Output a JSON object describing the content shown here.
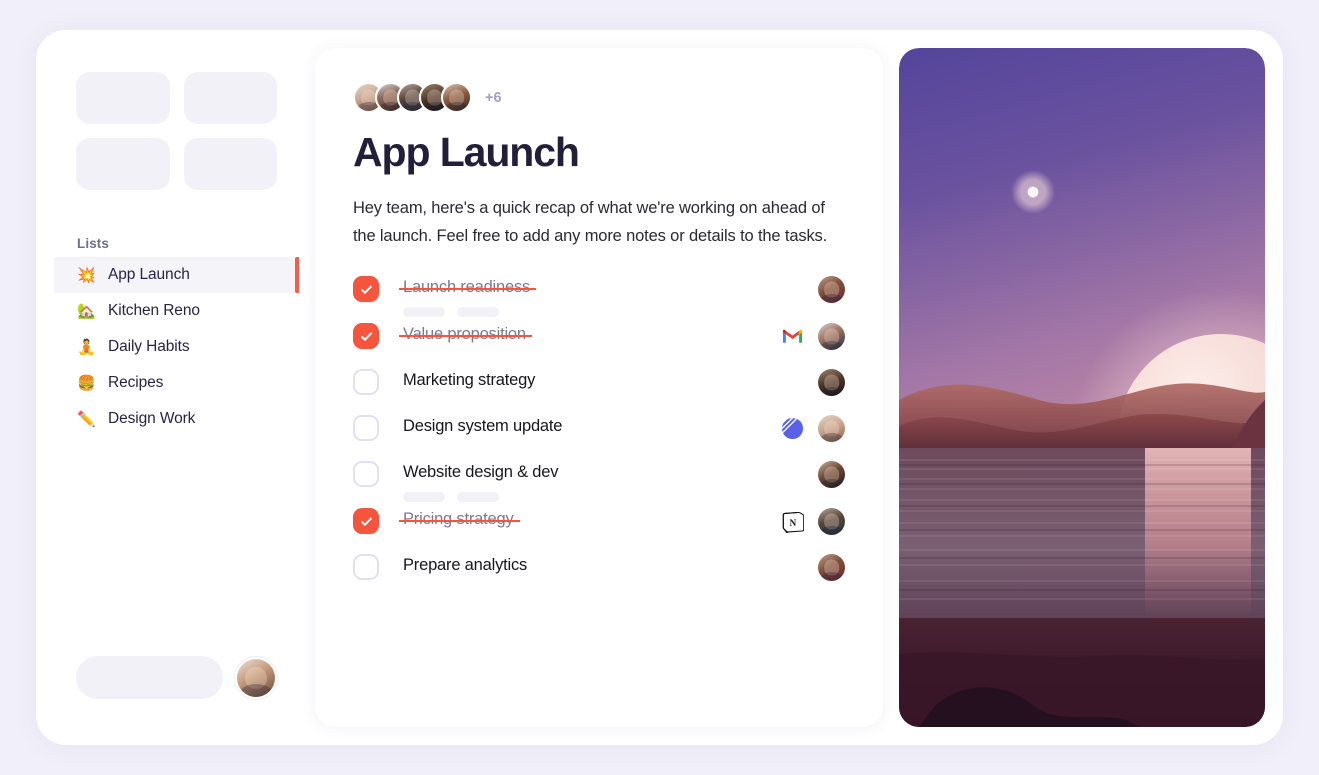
{
  "theme": {
    "page_background": "#f1eff9",
    "accent": "#f4553c",
    "card_background": "#ffffff",
    "muted_text": "#6f7186",
    "title_text": "#231f3b"
  },
  "sidebar": {
    "tiles_count": 4,
    "section_title": "Lists",
    "items": [
      {
        "emoji": "💥",
        "icon_name": "collision-emoji",
        "label": "App Launch",
        "active": true
      },
      {
        "emoji": "🏡",
        "icon_name": "house-with-garden-emoji",
        "label": "Kitchen Reno",
        "active": false
      },
      {
        "emoji": "🧘",
        "icon_name": "person-in-lotus-position-emoji",
        "label": "Daily Habits",
        "active": false
      },
      {
        "emoji": "🍔",
        "icon_name": "hamburger-emoji",
        "label": "Recipes",
        "active": false
      },
      {
        "emoji": "✏️",
        "icon_name": "pencil-emoji",
        "label": "Design Work",
        "active": false
      }
    ],
    "footer": {
      "pill_placeholder": "",
      "avatar_name": "current-user-avatar"
    }
  },
  "main": {
    "collaborators": {
      "visible_count": 5,
      "overflow_label": "+6"
    },
    "title": "App Launch",
    "description": "Hey team, here's a quick recap of what we're working on ahead of the launch. Feel free to add any more notes or details to the tasks.",
    "tasks": [
      {
        "title": "Launch readiness",
        "done": true,
        "subtasks": 2,
        "app_icon": "",
        "avatar_face": "f5"
      },
      {
        "title": "Value proposition",
        "done": true,
        "subtasks": 0,
        "app_icon": "gmail-icon",
        "avatar_face": "f6"
      },
      {
        "title": "Marketing strategy",
        "done": false,
        "subtasks": 0,
        "app_icon": "",
        "avatar_face": "f3"
      },
      {
        "title": "Design system update",
        "done": false,
        "subtasks": 0,
        "app_icon": "linear-icon",
        "avatar_face": "f0"
      },
      {
        "title": "Website design & dev",
        "done": false,
        "subtasks": 2,
        "app_icon": "",
        "avatar_face": "f7"
      },
      {
        "title": "Pricing strategy",
        "done": true,
        "subtasks": 0,
        "app_icon": "notion-icon",
        "avatar_face": "f2"
      },
      {
        "title": "Prepare analytics",
        "done": false,
        "subtasks": 0,
        "app_icon": "",
        "avatar_face": "f5"
      }
    ]
  },
  "photo_panel": {
    "alt": "Surreal desert lake at dusk with a large moon rising behind red dunes",
    "sky_top_color": "#5a4b9e",
    "sky_bottom_color": "#d4939f",
    "moon_color": "#f7dcd8",
    "water_color": "#6b4a63",
    "small_moon": true
  }
}
